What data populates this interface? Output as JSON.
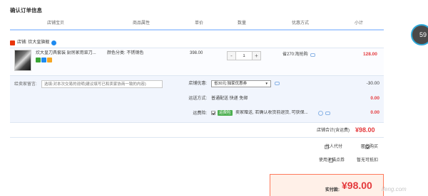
{
  "section_title": "确认订单信息",
  "columns": [
    "店铺宝贝",
    "商品属性",
    "单价",
    "数量",
    "优惠方式",
    "小计"
  ],
  "store": {
    "label": "店铺: 炊大皇旗舰"
  },
  "item": {
    "title": "炊大皇刀具套装 厨房家用菜刀...",
    "attributes": "颜色分类: 不锈钢色",
    "price": "398.00",
    "quantity": "1",
    "minus": "-",
    "plus": "+",
    "promo": "省270:淘抢购",
    "subtotal": "128.00"
  },
  "memo": {
    "label": "给卖家留言:",
    "placeholder": "选填:对本次交易的说明(建议填写已和卖家协商一致的内容)"
  },
  "coupon": {
    "label": "店铺优惠:",
    "selected": "省30元:独家优惠券",
    "arrow": "▼",
    "amount": "-30.00"
  },
  "shipping": {
    "label": "运送方式:",
    "value": "普通配送 快递 免邮",
    "amount": "0.00"
  },
  "insurance": {
    "label": "运费险:",
    "tag": "运费险",
    "desc": "卖家赠送, 若确认收货前退货, 可获保...",
    "amount": "0.00"
  },
  "store_total": {
    "label": "店铺合计(含运费)",
    "value": "¥98.00"
  },
  "options": {
    "anonymous_pay": "找人代付",
    "anonymous_buy": "匿名购买"
  },
  "points": {
    "label": "使用天猫点券",
    "value": "暂无可抵扣"
  },
  "payment": {
    "label": "实付款:",
    "value": "¥98.00"
  },
  "bubble": {
    "value": "59"
  },
  "watermark": {
    "text": "ifeng.com"
  }
}
